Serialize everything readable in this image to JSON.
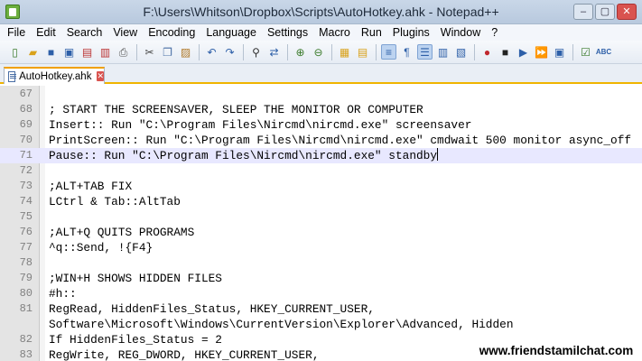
{
  "window": {
    "title": "F:\\Users\\Whitson\\Dropbox\\Scripts\\AutoHotkey.ahk - Notepad++",
    "controls": [
      "minimize-icon",
      "maximize-icon",
      "close-icon"
    ]
  },
  "menu": [
    "File",
    "Edit",
    "Search",
    "View",
    "Encoding",
    "Language",
    "Settings",
    "Macro",
    "Run",
    "Plugins",
    "Window",
    "?"
  ],
  "toolbar": {
    "icons": [
      "new-file-icon",
      "open-file-icon",
      "save-icon",
      "save-all-icon",
      "close-file-icon",
      "close-all-icon",
      "print-icon",
      "cut-icon",
      "copy-icon",
      "paste-icon",
      "undo-icon",
      "redo-icon",
      "find-icon",
      "replace-icon",
      "zoom-in-icon",
      "zoom-out-icon",
      "sync-vertical-icon",
      "sync-horizontal-icon",
      "word-wrap-icon",
      "show-all-chars-icon",
      "indent-guide-icon",
      "doc-map-icon",
      "function-list-icon",
      "record-macro-icon",
      "stop-macro-icon",
      "play-macro-icon",
      "play-multiple-icon",
      "save-macro-icon",
      "spell-check-icon",
      "abc-icon"
    ]
  },
  "tab": {
    "label": "AutoHotkey.ahk",
    "close_glyph": "✕"
  },
  "editor": {
    "lines": [
      {
        "num": "67",
        "text": ""
      },
      {
        "num": "68",
        "text": "; START THE SCREENSAVER, SLEEP THE MONITOR OR COMPUTER"
      },
      {
        "num": "69",
        "text": "Insert:: Run \"C:\\Program Files\\Nircmd\\nircmd.exe\" screensaver"
      },
      {
        "num": "70",
        "text": "PrintScreen:: Run \"C:\\Program Files\\Nircmd\\nircmd.exe\" cmdwait 500 monitor async_off"
      },
      {
        "num": "71",
        "text": "Pause:: Run \"C:\\Program Files\\Nircmd\\nircmd.exe\" standby"
      },
      {
        "num": "72",
        "text": ""
      },
      {
        "num": "73",
        "text": ";ALT+TAB FIX"
      },
      {
        "num": "74",
        "text": "LCtrl & Tab::AltTab"
      },
      {
        "num": "75",
        "text": ""
      },
      {
        "num": "76",
        "text": ";ALT+Q QUITS PROGRAMS"
      },
      {
        "num": "77",
        "text": "^q::Send, !{F4}"
      },
      {
        "num": "78",
        "text": ""
      },
      {
        "num": "79",
        "text": ";WIN+H SHOWS HIDDEN FILES"
      },
      {
        "num": "80",
        "text": "#h::"
      },
      {
        "num": "81",
        "text": "RegRead, HiddenFiles_Status, HKEY_CURRENT_USER,"
      },
      {
        "num": "",
        "text": "Software\\Microsoft\\Windows\\CurrentVersion\\Explorer\\Advanced, Hidden"
      },
      {
        "num": "82",
        "text": "If HiddenFiles_Status = 2"
      },
      {
        "num": "83",
        "text": "RegWrite, REG_DWORD, HKEY_CURRENT_USER,"
      }
    ],
    "current_line": "71"
  },
  "watermark": "www.friendstamilchat.com"
}
